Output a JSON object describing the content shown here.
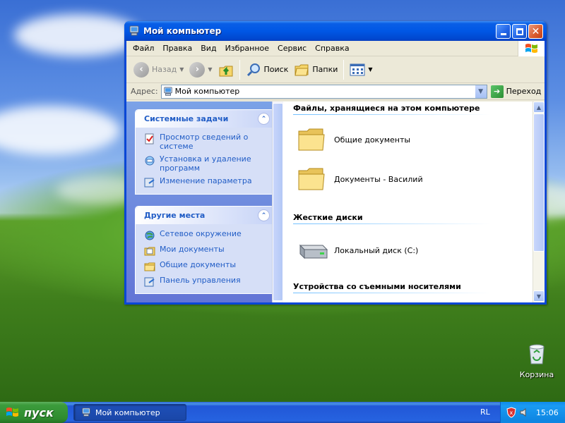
{
  "window": {
    "title": "Мой компьютер",
    "menu": [
      "Файл",
      "Правка",
      "Вид",
      "Избранное",
      "Сервис",
      "Справка"
    ],
    "toolbar": {
      "back_label": "Назад",
      "search_label": "Поиск",
      "folders_label": "Папки"
    },
    "address": {
      "label": "Адрес:",
      "value": "Мой компьютер",
      "go_label": "Переход"
    },
    "taskpane": {
      "system_tasks": {
        "title": "Системные задачи",
        "items": [
          "Просмотр сведений о системе",
          "Установка и удаление программ",
          "Изменение параметра"
        ]
      },
      "other_places": {
        "title": "Другие места",
        "items": [
          "Сетевое окружение",
          "Мои документы",
          "Общие документы",
          "Панель управления"
        ]
      }
    },
    "main": {
      "files_section": "Файлы, хранящиеся на этом компьютере",
      "files": [
        "Общие документы",
        "Документы - Василий"
      ],
      "drives_section": "Жесткие диски",
      "drives": [
        "Локальный диск (C:)"
      ],
      "removable_section": "Устройства со съемными носителями"
    }
  },
  "desktop": {
    "recycle_bin": "Корзина"
  },
  "taskbar": {
    "start_label": "пуск",
    "task_label": "Мой компьютер",
    "language": "RL",
    "clock": "15:06"
  }
}
